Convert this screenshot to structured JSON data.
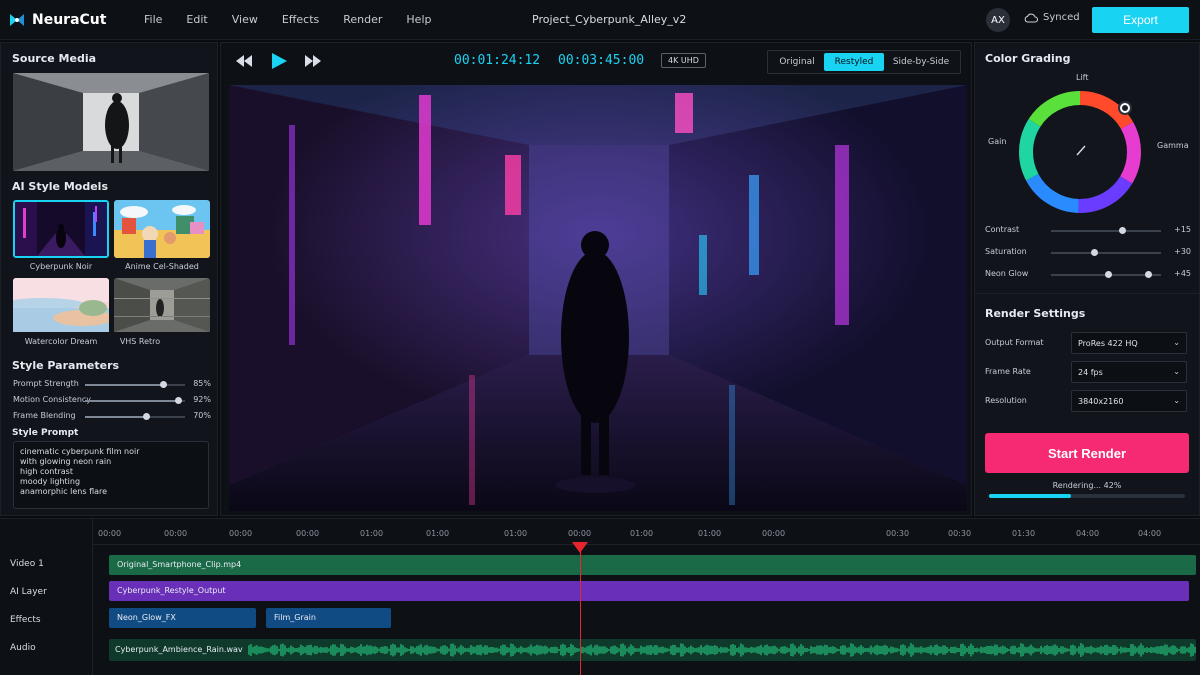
{
  "app": {
    "name": "NeuraCut",
    "project_title": "Project_Cyberpunk_Alley_v2",
    "user_initials": "AX",
    "sync_status": "Synced",
    "export_label": "Export"
  },
  "menu": [
    "File",
    "Edit",
    "View",
    "Effects",
    "Render",
    "Help"
  ],
  "left": {
    "source_title": "Source Media",
    "models_title": "AI Style Models",
    "models": [
      {
        "label": "Cyberpunk Noir",
        "selected": true
      },
      {
        "label": "Anime Cel-Shaded",
        "selected": false
      },
      {
        "label": "Watercolor Dream",
        "selected": false
      },
      {
        "label": "VHS Retro",
        "selected": false
      }
    ],
    "params_title": "Style Parameters",
    "params": [
      {
        "label": "Prompt Strength",
        "value": "85%",
        "level": 0.85
      },
      {
        "label": "Motion Consistency",
        "value": "92%",
        "level": 0.92
      },
      {
        "label": "Frame Blending",
        "value": "70%",
        "level": 0.7
      }
    ],
    "prompt_title": "Style Prompt",
    "prompt_text": "cinematic cyberpunk film noir\nwith glowing neon rain\nhigh contrast\nmoody lighting\nanamorphic lens flare"
  },
  "center": {
    "timecode_current": "00:01:24:12",
    "timecode_total": "00:03:45:00",
    "quality_badge": "4K UHD",
    "view_modes": [
      {
        "label": "Original",
        "active": false
      },
      {
        "label": "Restyled",
        "active": true
      },
      {
        "label": "Side-by-Side",
        "active": false
      }
    ]
  },
  "right": {
    "grading_title": "Color Grading",
    "wheel_labels": {
      "top": "Lift",
      "left": "Gain",
      "right": "Gamma"
    },
    "sliders": [
      {
        "label": "Contrast",
        "value": "+15",
        "level": 0.62
      },
      {
        "label": "Saturation",
        "value": "+30",
        "level": 0.38
      },
      {
        "label": "Neon Glow",
        "value": "+45",
        "level": 0.52
      }
    ],
    "render_title": "Render Settings",
    "settings": [
      {
        "label": "Output Format",
        "value": "ProRes 422 HQ"
      },
      {
        "label": "Frame Rate",
        "value": "24 fps"
      },
      {
        "label": "Resolution",
        "value": "3840x2160"
      }
    ],
    "render_button": "Start Render",
    "progress_label": "Rendering... 42%",
    "progress": 0.42
  },
  "timeline": {
    "ruler_ticks": [
      "00:00",
      "00:00",
      "00:00",
      "00:00",
      "01:00",
      "01:00",
      "01:00",
      "00:00",
      "01:00",
      "01:00",
      "00:00",
      "00:30",
      "00:30",
      "01:30",
      "04:00",
      "04:00"
    ],
    "tracks": [
      "Video 1",
      "AI Layer",
      "Effects",
      "Audio"
    ],
    "clips": {
      "video": "Original_Smartphone_Clip.mp4",
      "ai": "Cyberpunk_Restyle_Output",
      "fx1": "Neon_Glow_FX",
      "fx2": "Film_Grain",
      "audio": "Cyberpunk_Ambience_Rain.wav"
    }
  },
  "colors": {
    "accent": "#19d3f3",
    "render": "#f52a73",
    "video_clip": "#1a6a47",
    "ai_clip": "#6a2fb8",
    "fx_clip": "#114b84",
    "audio_clip": "#0f4a36"
  }
}
